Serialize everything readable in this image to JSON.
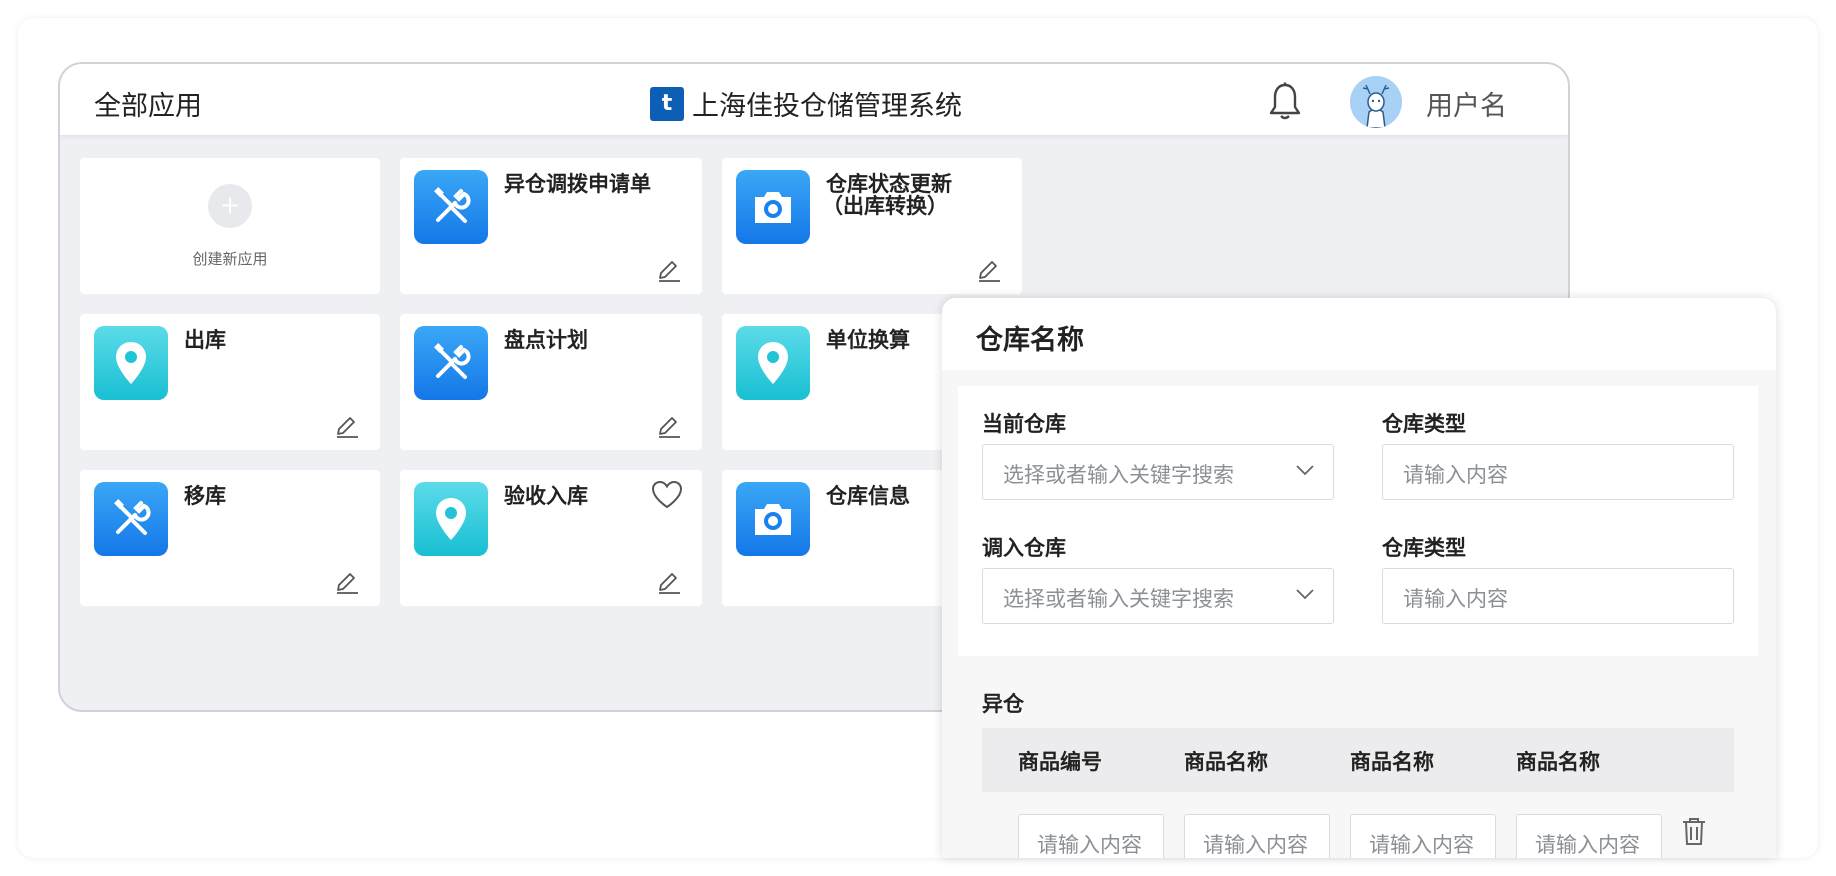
{
  "header": {
    "all_apps": "全部应用",
    "brand_logo_glyph": "t",
    "brand_title": "上海佳投仓储管理系统",
    "username": "用户名"
  },
  "apps": {
    "create_plus": "+",
    "create_label": "创建新应用",
    "items": [
      {
        "name": "异仓调拨申请单",
        "icon": "tools-icon",
        "color": "blue"
      },
      {
        "name": "仓库状态更新",
        "name2": "（出库转换）",
        "icon": "camera-icon",
        "color": "blue"
      },
      {
        "name": "出库",
        "icon": "location-pin-icon",
        "color": "teal"
      },
      {
        "name": "盘点计划",
        "icon": "tools-icon",
        "color": "blue"
      },
      {
        "name": "单位换算",
        "icon": "location-pin-icon",
        "color": "teal"
      },
      {
        "name": "移库",
        "icon": "tools-icon",
        "color": "blue"
      },
      {
        "name": "验收入库",
        "icon": "location-pin-icon",
        "color": "teal",
        "favorite": true
      },
      {
        "name": "仓库信息",
        "icon": "camera-icon",
        "color": "blue"
      }
    ]
  },
  "panel": {
    "title": "仓库名称",
    "current_warehouse_label": "当前仓库",
    "current_warehouse_placeholder": "选择或者输入关键字搜索",
    "warehouse_type_label_1": "仓库类型",
    "warehouse_type_placeholder_1": "请输入内容",
    "inbound_warehouse_label": "调入仓库",
    "inbound_warehouse_placeholder": "选择或者输入关键字搜索",
    "warehouse_type_label_2": "仓库类型",
    "warehouse_type_placeholder_2": "请输入内容",
    "section_label": "异仓",
    "table": {
      "columns": [
        "商品编号",
        "商品名称",
        "商品名称",
        "商品名称"
      ],
      "row_placeholders": [
        "请输入内容",
        "请输入内容",
        "请输入内容",
        "请输入内容"
      ]
    }
  },
  "colors": {
    "brand_blue": "#0d5fb5",
    "tile_blue": "#1a82ee",
    "tile_teal": "#22c3d6",
    "window_bg": "#eff0f3"
  }
}
